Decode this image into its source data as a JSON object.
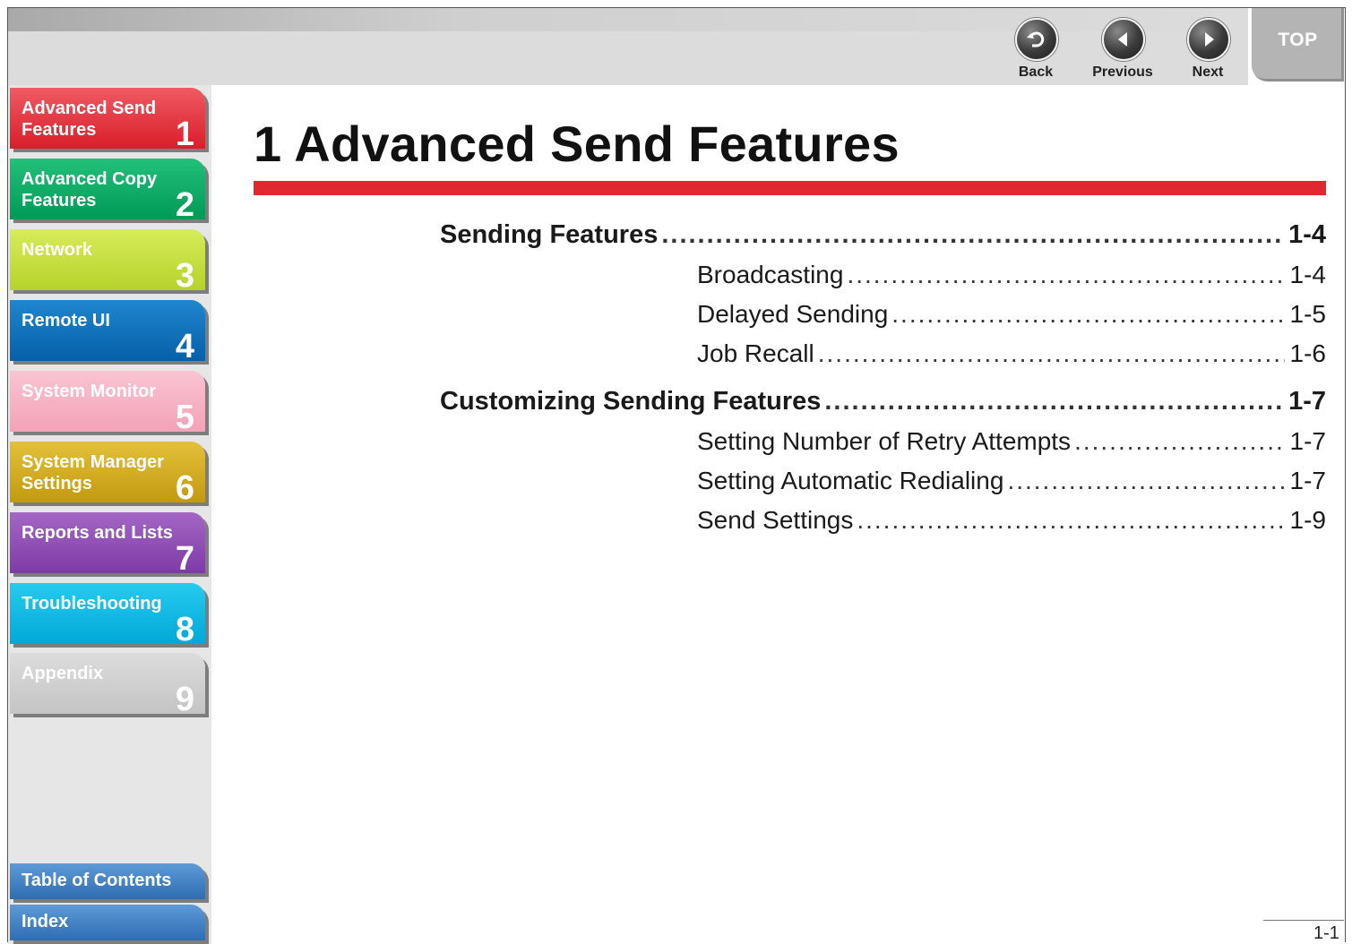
{
  "header": {
    "back_label": "Back",
    "previous_label": "Previous",
    "next_label": "Next",
    "top_label": "TOP"
  },
  "sidebar": {
    "tabs": [
      {
        "label": "Advanced Send\nFeatures",
        "number": "1"
      },
      {
        "label": "Advanced Copy\nFeatures",
        "number": "2"
      },
      {
        "label": "Network",
        "number": "3"
      },
      {
        "label": "Remote UI",
        "number": "4"
      },
      {
        "label": "System Monitor",
        "number": "5"
      },
      {
        "label": "System Manager\nSettings",
        "number": "6"
      },
      {
        "label": "Reports and Lists",
        "number": "7"
      },
      {
        "label": "Troubleshooting",
        "number": "8"
      },
      {
        "label": "Appendix",
        "number": "9"
      }
    ],
    "table_of_contents_label": "Table of Contents",
    "index_label": "Index"
  },
  "chapter": {
    "title": "1 Advanced Send Features"
  },
  "toc": [
    {
      "level": 1,
      "title": "Sending Features",
      "page": "1-4"
    },
    {
      "level": 2,
      "title": "Broadcasting",
      "page": "1-4"
    },
    {
      "level": 2,
      "title": "Delayed Sending",
      "page": "1-5"
    },
    {
      "level": 2,
      "title": "Job Recall",
      "page": "1-6"
    },
    {
      "level": 1,
      "title": "Customizing Sending Features",
      "page": "1-7"
    },
    {
      "level": 2,
      "title": "Setting Number of Retry Attempts",
      "page": "1-7"
    },
    {
      "level": 2,
      "title": "Setting Automatic Redialing",
      "page": "1-7"
    },
    {
      "level": 2,
      "title": "Send Settings",
      "page": "1-9"
    }
  ],
  "footer": {
    "page_number": "1-1"
  }
}
